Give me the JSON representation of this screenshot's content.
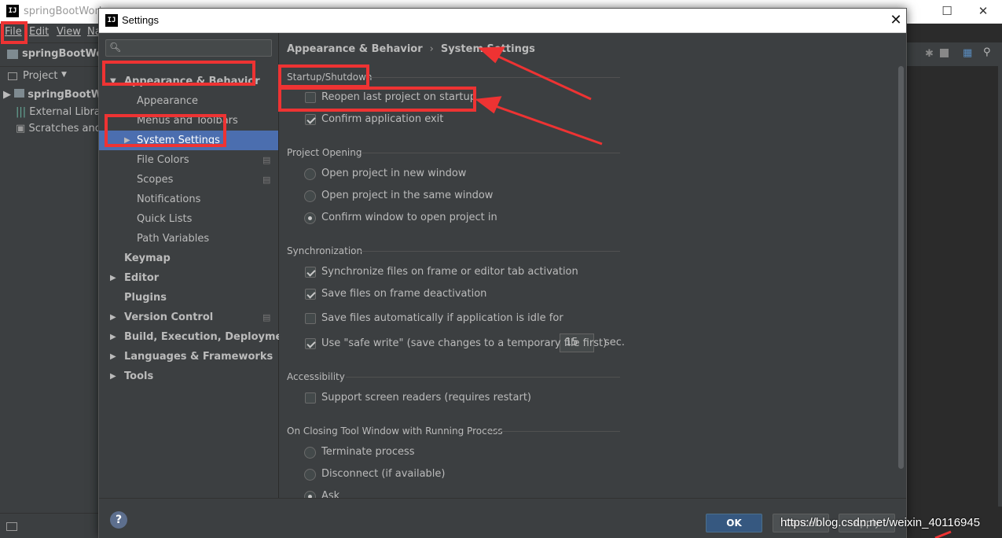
{
  "ide": {
    "title": "springBootWork",
    "menu": {
      "file": "File",
      "edit": "Edit",
      "view": "View",
      "nav": "Na"
    },
    "navbar_project": "springBootWork",
    "project_header": "Project",
    "tree": [
      "springBootWork",
      "External Librari",
      "Scratches and"
    ]
  },
  "dialog": {
    "title": "Settings",
    "search_placeholder": "",
    "tree": [
      {
        "label": "Appearance & Behavior",
        "bold": true,
        "expanded": true
      },
      {
        "label": "Appearance"
      },
      {
        "label": "Menus and Toolbars"
      },
      {
        "label": "System Settings",
        "selected": true
      },
      {
        "label": "File Colors"
      },
      {
        "label": "Scopes"
      },
      {
        "label": "Notifications"
      },
      {
        "label": "Quick Lists"
      },
      {
        "label": "Path Variables"
      },
      {
        "label": "Keymap",
        "bold": true
      },
      {
        "label": "Editor",
        "bold": true
      },
      {
        "label": "Plugins",
        "bold": true
      },
      {
        "label": "Version Control",
        "bold": true
      },
      {
        "label": "Build, Execution, Deployment",
        "bold": true
      },
      {
        "label": "Languages & Frameworks",
        "bold": true
      },
      {
        "label": "Tools",
        "bold": true
      }
    ],
    "breadcrumb": {
      "parent": "Appearance & Behavior",
      "sep": "›",
      "current": "System Settings"
    },
    "sections": {
      "startup": {
        "title": "Startup/Shutdown",
        "reopen": {
          "label": "Reopen last project on startup",
          "checked": false
        },
        "confirm_exit": {
          "label": "Confirm application exit",
          "checked": true
        }
      },
      "project_opening": {
        "title": "Project Opening",
        "new_window": {
          "label": "Open project in new window",
          "selected": false
        },
        "same_window": {
          "label": "Open project in the same window",
          "selected": false
        },
        "confirm_window": {
          "label": "Confirm window to open project in",
          "selected": true
        }
      },
      "sync": {
        "title": "Synchronization",
        "sync_files": {
          "label": "Synchronize files on frame or editor tab activation",
          "checked": true
        },
        "save_deactivation": {
          "label": "Save files on frame deactivation",
          "checked": true
        },
        "save_idle": {
          "label": "Save files automatically if application is idle for",
          "checked": false,
          "value": "15",
          "unit": "sec."
        },
        "safe_write": {
          "label": "Use \"safe write\" (save changes to a temporary file first)",
          "checked": true
        }
      },
      "accessibility": {
        "title": "Accessibility",
        "screen_readers": {
          "label": "Support screen readers (requires restart)",
          "checked": false
        }
      },
      "closing": {
        "title": "On Closing Tool Window with Running Process",
        "terminate": {
          "label": "Terminate process",
          "selected": false
        },
        "disconnect": {
          "label": "Disconnect (if available)",
          "selected": false
        },
        "ask": {
          "label": "Ask",
          "selected": true
        }
      }
    },
    "footer": {
      "help": "?",
      "ok": "OK",
      "cancel": "Cancel",
      "apply": "Apply"
    }
  },
  "watermark": "https://blog.csdn.net/weixin_40116945",
  "annotation_color": "#ee3333"
}
